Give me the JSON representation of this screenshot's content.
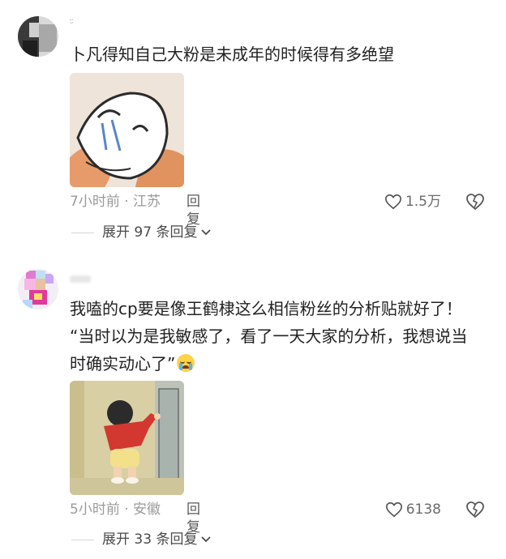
{
  "comments": [
    {
      "username": "ᵕ̈",
      "text": "卜凡得知自己大粉是未成年的时候得有多绝望",
      "time_location": "7小时前 · 江苏",
      "reply_label": "回复",
      "like_count": "1.5万",
      "expand_label": "展开 97 条回复"
    },
    {
      "username": "",
      "text_line1": "我嗑的cp要是像王鹤棣这么相信粉丝的分析贴就好了！",
      "text_line2": "“当时以为是我敏感了，看了一天大家的分析，我想说当",
      "text_line3": "时确实动心了”",
      "time_location": "5小时前 · 安徽",
      "reply_label": "回复",
      "like_count": "6138",
      "expand_label": "展开 33 条回复"
    }
  ],
  "icons": [
    "heart-outline-icon",
    "dislike-heart-icon",
    "chevron-down-icon",
    "crying-emoji-icon"
  ]
}
